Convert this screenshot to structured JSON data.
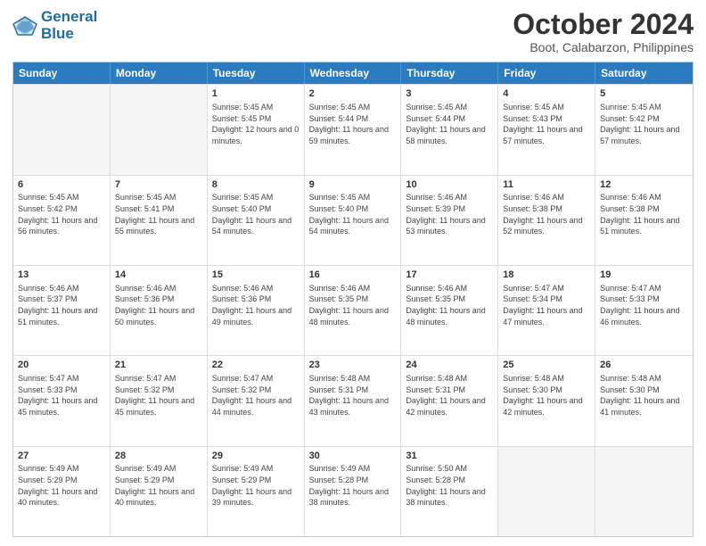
{
  "logo": {
    "line1": "General",
    "line2": "Blue"
  },
  "title": "October 2024",
  "subtitle": "Boot, Calabarzon, Philippines",
  "days": [
    "Sunday",
    "Monday",
    "Tuesday",
    "Wednesday",
    "Thursday",
    "Friday",
    "Saturday"
  ],
  "rows": [
    [
      {
        "day": "",
        "empty": true
      },
      {
        "day": "",
        "empty": true
      },
      {
        "day": "1",
        "sunrise": "Sunrise: 5:45 AM",
        "sunset": "Sunset: 5:45 PM",
        "daylight": "Daylight: 12 hours and 0 minutes."
      },
      {
        "day": "2",
        "sunrise": "Sunrise: 5:45 AM",
        "sunset": "Sunset: 5:44 PM",
        "daylight": "Daylight: 11 hours and 59 minutes."
      },
      {
        "day": "3",
        "sunrise": "Sunrise: 5:45 AM",
        "sunset": "Sunset: 5:44 PM",
        "daylight": "Daylight: 11 hours and 58 minutes."
      },
      {
        "day": "4",
        "sunrise": "Sunrise: 5:45 AM",
        "sunset": "Sunset: 5:43 PM",
        "daylight": "Daylight: 11 hours and 57 minutes."
      },
      {
        "day": "5",
        "sunrise": "Sunrise: 5:45 AM",
        "sunset": "Sunset: 5:42 PM",
        "daylight": "Daylight: 11 hours and 57 minutes."
      }
    ],
    [
      {
        "day": "6",
        "sunrise": "Sunrise: 5:45 AM",
        "sunset": "Sunset: 5:42 PM",
        "daylight": "Daylight: 11 hours and 56 minutes."
      },
      {
        "day": "7",
        "sunrise": "Sunrise: 5:45 AM",
        "sunset": "Sunset: 5:41 PM",
        "daylight": "Daylight: 11 hours and 55 minutes."
      },
      {
        "day": "8",
        "sunrise": "Sunrise: 5:45 AM",
        "sunset": "Sunset: 5:40 PM",
        "daylight": "Daylight: 11 hours and 54 minutes."
      },
      {
        "day": "9",
        "sunrise": "Sunrise: 5:45 AM",
        "sunset": "Sunset: 5:40 PM",
        "daylight": "Daylight: 11 hours and 54 minutes."
      },
      {
        "day": "10",
        "sunrise": "Sunrise: 5:46 AM",
        "sunset": "Sunset: 5:39 PM",
        "daylight": "Daylight: 11 hours and 53 minutes."
      },
      {
        "day": "11",
        "sunrise": "Sunrise: 5:46 AM",
        "sunset": "Sunset: 5:38 PM",
        "daylight": "Daylight: 11 hours and 52 minutes."
      },
      {
        "day": "12",
        "sunrise": "Sunrise: 5:46 AM",
        "sunset": "Sunset: 5:38 PM",
        "daylight": "Daylight: 11 hours and 51 minutes."
      }
    ],
    [
      {
        "day": "13",
        "sunrise": "Sunrise: 5:46 AM",
        "sunset": "Sunset: 5:37 PM",
        "daylight": "Daylight: 11 hours and 51 minutes."
      },
      {
        "day": "14",
        "sunrise": "Sunrise: 5:46 AM",
        "sunset": "Sunset: 5:36 PM",
        "daylight": "Daylight: 11 hours and 50 minutes."
      },
      {
        "day": "15",
        "sunrise": "Sunrise: 5:46 AM",
        "sunset": "Sunset: 5:36 PM",
        "daylight": "Daylight: 11 hours and 49 minutes."
      },
      {
        "day": "16",
        "sunrise": "Sunrise: 5:46 AM",
        "sunset": "Sunset: 5:35 PM",
        "daylight": "Daylight: 11 hours and 48 minutes."
      },
      {
        "day": "17",
        "sunrise": "Sunrise: 5:46 AM",
        "sunset": "Sunset: 5:35 PM",
        "daylight": "Daylight: 11 hours and 48 minutes."
      },
      {
        "day": "18",
        "sunrise": "Sunrise: 5:47 AM",
        "sunset": "Sunset: 5:34 PM",
        "daylight": "Daylight: 11 hours and 47 minutes."
      },
      {
        "day": "19",
        "sunrise": "Sunrise: 5:47 AM",
        "sunset": "Sunset: 5:33 PM",
        "daylight": "Daylight: 11 hours and 46 minutes."
      }
    ],
    [
      {
        "day": "20",
        "sunrise": "Sunrise: 5:47 AM",
        "sunset": "Sunset: 5:33 PM",
        "daylight": "Daylight: 11 hours and 45 minutes."
      },
      {
        "day": "21",
        "sunrise": "Sunrise: 5:47 AM",
        "sunset": "Sunset: 5:32 PM",
        "daylight": "Daylight: 11 hours and 45 minutes."
      },
      {
        "day": "22",
        "sunrise": "Sunrise: 5:47 AM",
        "sunset": "Sunset: 5:32 PM",
        "daylight": "Daylight: 11 hours and 44 minutes."
      },
      {
        "day": "23",
        "sunrise": "Sunrise: 5:48 AM",
        "sunset": "Sunset: 5:31 PM",
        "daylight": "Daylight: 11 hours and 43 minutes."
      },
      {
        "day": "24",
        "sunrise": "Sunrise: 5:48 AM",
        "sunset": "Sunset: 5:31 PM",
        "daylight": "Daylight: 11 hours and 42 minutes."
      },
      {
        "day": "25",
        "sunrise": "Sunrise: 5:48 AM",
        "sunset": "Sunset: 5:30 PM",
        "daylight": "Daylight: 11 hours and 42 minutes."
      },
      {
        "day": "26",
        "sunrise": "Sunrise: 5:48 AM",
        "sunset": "Sunset: 5:30 PM",
        "daylight": "Daylight: 11 hours and 41 minutes."
      }
    ],
    [
      {
        "day": "27",
        "sunrise": "Sunrise: 5:49 AM",
        "sunset": "Sunset: 5:29 PM",
        "daylight": "Daylight: 11 hours and 40 minutes."
      },
      {
        "day": "28",
        "sunrise": "Sunrise: 5:49 AM",
        "sunset": "Sunset: 5:29 PM",
        "daylight": "Daylight: 11 hours and 40 minutes."
      },
      {
        "day": "29",
        "sunrise": "Sunrise: 5:49 AM",
        "sunset": "Sunset: 5:29 PM",
        "daylight": "Daylight: 11 hours and 39 minutes."
      },
      {
        "day": "30",
        "sunrise": "Sunrise: 5:49 AM",
        "sunset": "Sunset: 5:28 PM",
        "daylight": "Daylight: 11 hours and 38 minutes."
      },
      {
        "day": "31",
        "sunrise": "Sunrise: 5:50 AM",
        "sunset": "Sunset: 5:28 PM",
        "daylight": "Daylight: 11 hours and 38 minutes."
      },
      {
        "day": "",
        "empty": true
      },
      {
        "day": "",
        "empty": true
      }
    ]
  ]
}
